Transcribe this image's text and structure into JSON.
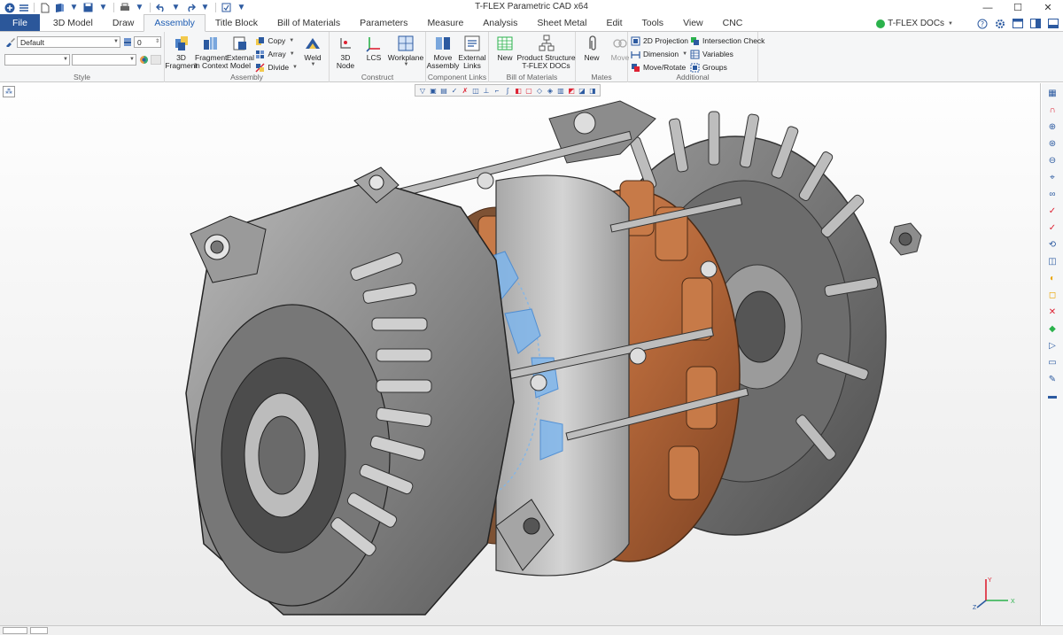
{
  "window": {
    "title": "T-FLEX Parametric CAD x64"
  },
  "quick_access": [
    "app-logo-icon",
    "menu-icon",
    "new-file-icon",
    "open-icon",
    "open-dropdown-icon",
    "save-icon",
    "save-dropdown-icon",
    "print-icon",
    "print-dropdown-icon",
    "undo-icon",
    "undo-dropdown-icon",
    "redo-icon",
    "redo-dropdown-icon",
    "export-icon",
    "customize-dropdown-icon"
  ],
  "menu": {
    "tabs": [
      "File",
      "3D Model",
      "Draw",
      "Assembly",
      "Title Block",
      "Bill of Materials",
      "Parameters",
      "Measure",
      "Analysis",
      "Sheet Metal",
      "Edit",
      "Tools",
      "View",
      "CNC"
    ],
    "active_tab": "Assembly",
    "tdocs_label": "T-FLEX DOCs"
  },
  "ribbon": {
    "style": {
      "layer_value": "Default",
      "level_value": "0",
      "label": "Style"
    },
    "assembly": {
      "label": "Assembly",
      "fragment_3d": "3D\nFragment",
      "fragment_in_context": "Fragment\nin Context",
      "external_model": "External\nModel",
      "copy": "Copy",
      "array": "Array",
      "divide": "Divide",
      "weld": "Weld"
    },
    "construct": {
      "label": "Construct",
      "node_3d": "3D\nNode",
      "lcs": "LCS",
      "workplane": "Workplane"
    },
    "component_links": {
      "label": "Component Links",
      "move_assembly": "Move\nAssembly",
      "external_links": "External\nLinks"
    },
    "bill_of_materials": {
      "label": "Bill of Materials",
      "new": "New",
      "product_structure": "Product Structure\nT-FLEX DOCs"
    },
    "mates": {
      "label": "Mates",
      "new": "New",
      "move": "Move"
    },
    "additional": {
      "label": "Additional",
      "projection_2d": "2D Projection",
      "dimension": "Dimension",
      "move_rotate": "Move/Rotate",
      "intersection_check": "Intersection Check",
      "variables": "Variables",
      "groups": "Groups"
    }
  },
  "viewport": {
    "model": "alternator-assembly-exploded-view",
    "axis_labels": {
      "x": "X",
      "y": "Y",
      "z": "Z"
    }
  },
  "colors": {
    "file_tab": "#2b579a",
    "accent": "#1e5db3",
    "copper": "#b5683a",
    "housing": "#8a8a8a",
    "highlight": "#7fb6ec"
  }
}
